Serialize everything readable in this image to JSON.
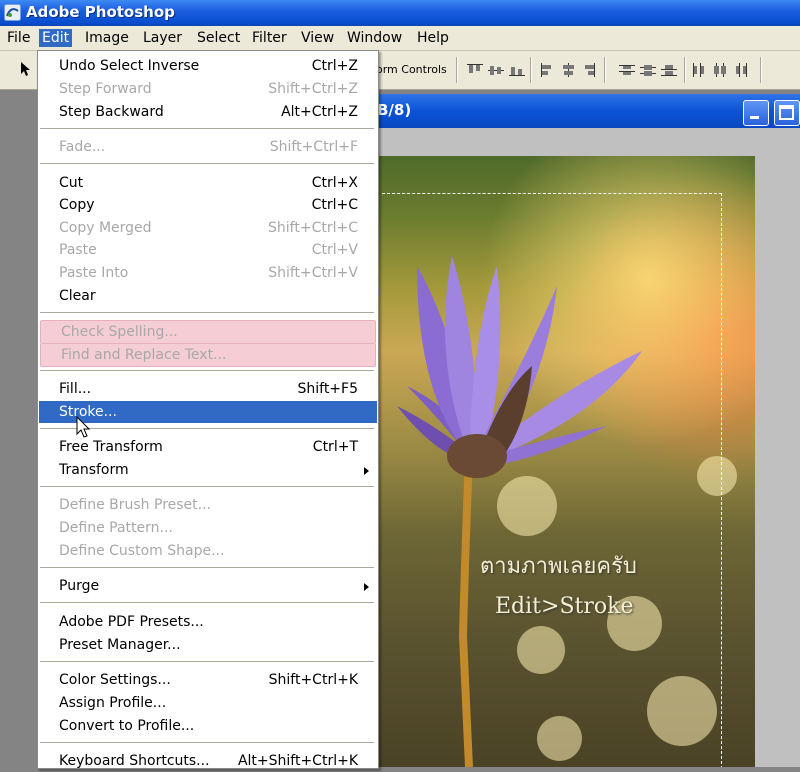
{
  "app": {
    "title": "Adobe Photoshop"
  },
  "menubar": [
    "File",
    "Edit",
    "Image",
    "Layer",
    "Select",
    "Filter",
    "View",
    "Window",
    "Help"
  ],
  "active_menu": "Edit",
  "options_bar": {
    "transform_controls_label": "orm Controls"
  },
  "document": {
    "title_fragment": "B/8)"
  },
  "edit_menu": [
    {
      "label": "Undo Select Inverse",
      "shortcut": "Ctrl+Z",
      "state": "enabled"
    },
    {
      "label": "Step Forward",
      "shortcut": "Shift+Ctrl+Z",
      "state": "disabled"
    },
    {
      "label": "Step Backward",
      "shortcut": "Alt+Ctrl+Z",
      "state": "enabled"
    },
    {
      "label": "Fade...",
      "shortcut": "Shift+Ctrl+F",
      "state": "disabled"
    },
    {
      "label": "Cut",
      "shortcut": "Ctrl+X",
      "state": "enabled"
    },
    {
      "label": "Copy",
      "shortcut": "Ctrl+C",
      "state": "enabled"
    },
    {
      "label": "Copy Merged",
      "shortcut": "Shift+Ctrl+C",
      "state": "disabled"
    },
    {
      "label": "Paste",
      "shortcut": "Ctrl+V",
      "state": "disabled"
    },
    {
      "label": "Paste Into",
      "shortcut": "Shift+Ctrl+V",
      "state": "disabled"
    },
    {
      "label": "Clear",
      "shortcut": "",
      "state": "enabled"
    },
    {
      "label": "Check Spelling...",
      "shortcut": "",
      "state": "disabled-pink"
    },
    {
      "label": "Find and Replace Text...",
      "shortcut": "",
      "state": "disabled-pink"
    },
    {
      "label": "Fill...",
      "shortcut": "Shift+F5",
      "state": "enabled"
    },
    {
      "label": "Stroke...",
      "shortcut": "",
      "state": "highlighted"
    },
    {
      "label": "Free Transform",
      "shortcut": "Ctrl+T",
      "state": "enabled"
    },
    {
      "label": "Transform",
      "shortcut": "",
      "state": "submenu"
    },
    {
      "label": "Define Brush Preset...",
      "shortcut": "",
      "state": "disabled"
    },
    {
      "label": "Define Pattern...",
      "shortcut": "",
      "state": "disabled"
    },
    {
      "label": "Define Custom Shape...",
      "shortcut": "",
      "state": "disabled"
    },
    {
      "label": "Purge",
      "shortcut": "",
      "state": "submenu"
    },
    {
      "label": "Adobe PDF Presets...",
      "shortcut": "",
      "state": "enabled"
    },
    {
      "label": "Preset Manager...",
      "shortcut": "",
      "state": "enabled"
    },
    {
      "label": "Color Settings...",
      "shortcut": "Shift+Ctrl+K",
      "state": "enabled"
    },
    {
      "label": "Assign Profile...",
      "shortcut": "",
      "state": "enabled"
    },
    {
      "label": "Convert to Profile...",
      "shortcut": "",
      "state": "enabled"
    },
    {
      "label": "Keyboard Shortcuts...",
      "shortcut": "Alt+Shift+Ctrl+K",
      "state": "enabled"
    }
  ],
  "canvas_caption": {
    "line1": "ตามภาพเลยครับ",
    "line2": "Edit>Stroke"
  },
  "colors": {
    "title_bar": "#0a4ed0",
    "menu_highlight": "#316ac5",
    "menu_bg": "#ece9d8",
    "pink_disabled": "#f5cdd5"
  }
}
